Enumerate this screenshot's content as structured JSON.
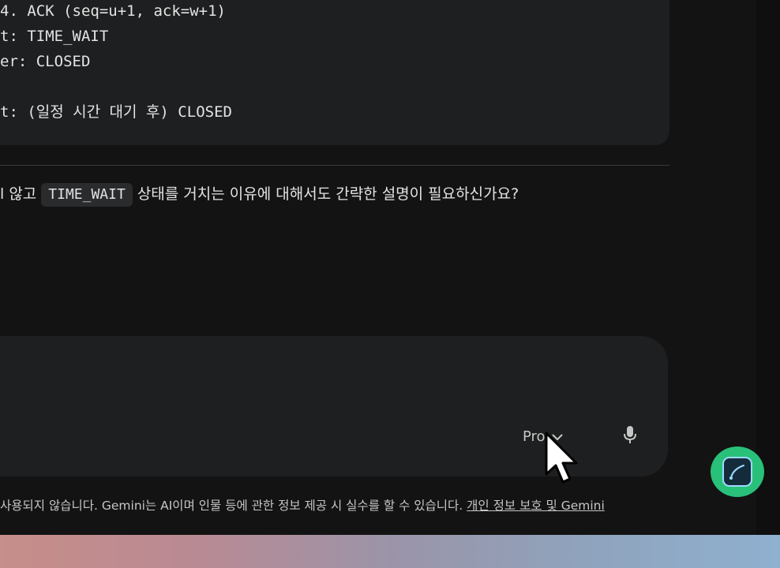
{
  "code_block": {
    "lines": [
      "4. ACK (seq=u+1, ack=w+1)",
      "t: TIME_WAIT",
      "er: CLOSED",
      "",
      "t: (일정 시간 대기 후) CLOSED"
    ]
  },
  "answer": {
    "before": "l 않고",
    "code": "TIME_WAIT",
    "after": "상태를 거치는 이유에 대해서도 간략한 설명이 필요하신가요?"
  },
  "input": {
    "model_label": "Pro",
    "mic_icon": "mic-icon",
    "chevron_icon": "chevron-down-icon"
  },
  "footer": {
    "text": "사용되지 않습니다. Gemini는 AI이며 인물 등에 관한 정보 제공 시 실수를 할 수 있습니다.",
    "link": "개인 정보 보호 및 Gemini"
  },
  "fab": {
    "icon": "pen-curve-icon",
    "accent": "#29c07a"
  },
  "colors": {
    "background": "#131313",
    "surface": "#1e1f20",
    "text": "#e3e3e3"
  }
}
